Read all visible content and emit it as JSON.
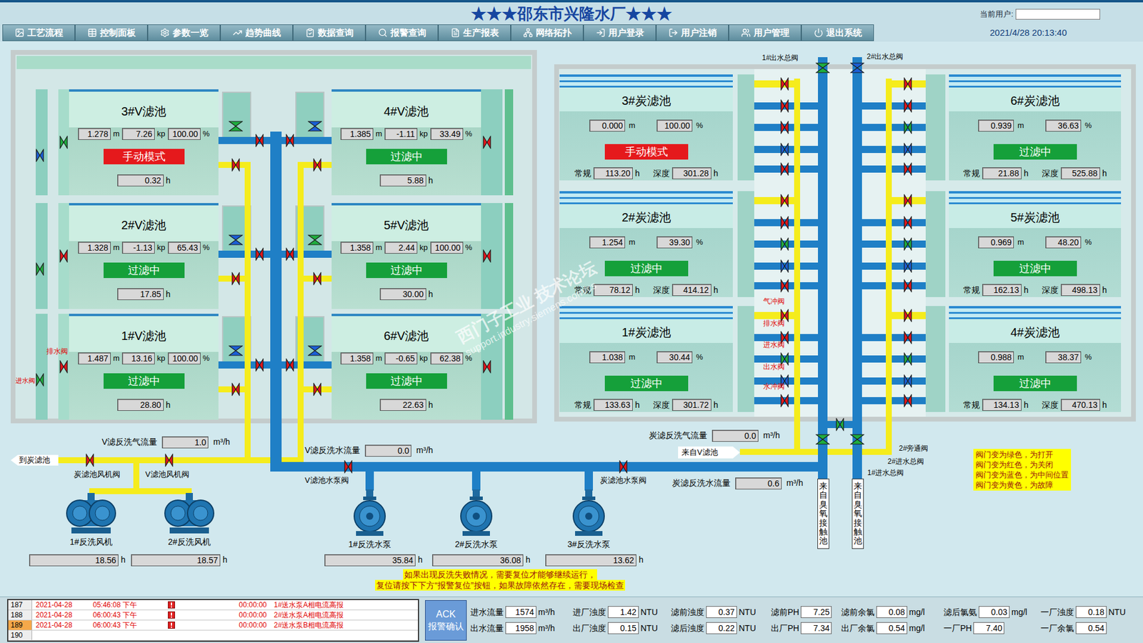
{
  "header": {
    "title": "★★★邵东市兴隆水厂★★★",
    "user_label": "当前用户:",
    "user_value": ""
  },
  "menu": [
    "工艺流程",
    "控制面板",
    "参数一览",
    "趋势曲线",
    "数据查询",
    "报警查询",
    "生产报表",
    "网络拓扑",
    "用户登录",
    "用户注销",
    "用户管理",
    "退出系统"
  ],
  "datetime": "2021/4/28 20:13:40",
  "v_units": {
    "level": "m",
    "pressure": "kp",
    "opening": "%",
    "hours": "h"
  },
  "v_filters": [
    {
      "name": "3#V滤池",
      "level": "1.278",
      "pressure": "7.26",
      "opening": "100.00",
      "status": "手动模式",
      "status_kind": "manual",
      "hours": "0.32",
      "valves": {
        "inlet": "middle",
        "drain": "open",
        "outlet": "open",
        "water": "closed",
        "air": "closed"
      }
    },
    {
      "name": "4#V滤池",
      "level": "1.385",
      "pressure": "-1.11",
      "opening": "33.49",
      "status": "过滤中",
      "status_kind": "filtering",
      "hours": "5.88",
      "valves": {
        "drain": "closed",
        "outlet": "middle",
        "water": "closed",
        "air": "closed"
      }
    },
    {
      "name": "2#V滤池",
      "level": "1.328",
      "pressure": "-1.13",
      "opening": "65.43",
      "status": "过滤中",
      "status_kind": "filtering",
      "hours": "17.85",
      "valves": {
        "inlet": "open",
        "drain": "closed",
        "outlet": "middle",
        "water": "closed",
        "air": "closed"
      }
    },
    {
      "name": "5#V滤池",
      "level": "1.358",
      "pressure": "2.44",
      "opening": "100.00",
      "status": "过滤中",
      "status_kind": "filtering",
      "hours": "30.00",
      "valves": {
        "drain": "closed",
        "outlet": "open",
        "water": "closed",
        "air": "closed"
      }
    },
    {
      "name": "1#V滤池",
      "level": "1.487",
      "pressure": "13.16",
      "opening": "100.00",
      "status": "过滤中",
      "status_kind": "filtering",
      "hours": "28.80",
      "valves": {
        "inlet": "open",
        "drain": "closed",
        "outlet": "middle",
        "water": "closed",
        "air": "closed"
      }
    },
    {
      "name": "6#V滤池",
      "level": "1.358",
      "pressure": "-0.65",
      "opening": "62.38",
      "status": "过滤中",
      "status_kind": "filtering",
      "hours": "22.63",
      "valves": {
        "drain": "closed",
        "outlet": "middle",
        "water": "closed",
        "air": "closed"
      }
    }
  ],
  "v_valve_labels": {
    "drain": "排水阀",
    "inlet": "进水阀"
  },
  "c_units": {
    "level": "m",
    "opening": "%",
    "normal": "常规",
    "deep": "深度",
    "hours": "h"
  },
  "carbon_filters": [
    {
      "name": "3#炭滤池",
      "level": "0.000",
      "opening": "100.00",
      "status": "手动模式",
      "status_kind": "manual",
      "normal_hours": "113.20",
      "deep_hours": "301.28",
      "valves": [
        "closed",
        "closed",
        "closed",
        "middle",
        "closed"
      ]
    },
    {
      "name": "6#炭滤池",
      "level": "0.939",
      "opening": "36.63",
      "status": "过滤中",
      "status_kind": "filtering",
      "normal_hours": "21.88",
      "deep_hours": "525.88",
      "valves": [
        "closed",
        "closed",
        "open",
        "middle",
        "closed"
      ]
    },
    {
      "name": "2#炭滤池",
      "level": "1.254",
      "opening": "39.30",
      "status": "过滤中",
      "status_kind": "filtering",
      "normal_hours": "78.12",
      "deep_hours": "414.12",
      "valves": [
        "closed",
        "closed",
        "open",
        "middle",
        "closed"
      ]
    },
    {
      "name": "5#炭滤池",
      "level": "0.969",
      "opening": "48.20",
      "status": "过滤中",
      "status_kind": "filtering",
      "normal_hours": "162.13",
      "deep_hours": "498.13",
      "valves": [
        "closed",
        "closed",
        "open",
        "middle",
        "closed"
      ]
    },
    {
      "name": "1#炭滤池",
      "level": "1.038",
      "opening": "30.44",
      "status": "过滤中",
      "status_kind": "filtering",
      "normal_hours": "133.63",
      "deep_hours": "301.72",
      "valves": [
        "closed",
        "closed",
        "open",
        "middle",
        "closed"
      ]
    },
    {
      "name": "4#炭滤池",
      "level": "0.988",
      "opening": "38.37",
      "status": "过滤中",
      "status_kind": "filtering",
      "normal_hours": "134.13",
      "deep_hours": "470.13",
      "valves": [
        "closed",
        "closed",
        "open",
        "middle",
        "closed"
      ]
    }
  ],
  "carbon_valve_labels": [
    "气冲阀",
    "排水阀",
    "进水阀",
    "出水阀",
    "水冲阀"
  ],
  "main_valves": [
    {
      "label": "1#出水总阀",
      "state": "open"
    },
    {
      "label": "2#出水总阀",
      "state": "middle"
    },
    {
      "label": "1#进水总阀",
      "state": "open"
    },
    {
      "label": "2#进水总阀",
      "state": "open"
    },
    {
      "label": "2#旁通阀",
      "state": "open"
    }
  ],
  "line_valves": [
    {
      "label": "炭滤池风机阀",
      "state": "closed"
    },
    {
      "label": "V滤池风机阀",
      "state": "closed"
    },
    {
      "label": "V滤池水泵阀",
      "state": "closed"
    },
    {
      "label": "炭滤池水泵阀",
      "state": "closed"
    }
  ],
  "flows": [
    {
      "label": "V滤反洗气流量",
      "value": "1.0",
      "unit": "m³/h"
    },
    {
      "label": "V滤反洗水流量",
      "value": "0.0",
      "unit": "m³/h"
    },
    {
      "label": "炭滤反洗气流量",
      "value": "0.0",
      "unit": "m³/h"
    },
    {
      "label": "炭滤反洗水流量",
      "value": "0.6",
      "unit": "m³/h"
    }
  ],
  "equipment_hours_unit": "h",
  "fans": [
    {
      "name": "1#反洗风机",
      "hours": "18.56"
    },
    {
      "name": "2#反洗风机",
      "hours": "18.57"
    }
  ],
  "pumps": [
    {
      "name": "1#反洗水泵",
      "hours": "35.84"
    },
    {
      "name": "2#反洗水泵",
      "hours": "36.08"
    },
    {
      "name": "3#反洗水泵",
      "hours": "13.62"
    }
  ],
  "arrows": {
    "to_carbon": "到炭滤池",
    "from_v": "来自V滤池",
    "from_ozone": [
      "来自臭氧接触池",
      "来自臭氧接触池"
    ]
  },
  "legend": [
    "阀门变为绿色，为打开",
    "阀门变为红色，为关闭",
    "阀门变为蓝色，为中间位置",
    "阀门变为黄色，为故障"
  ],
  "notice": [
    "如果出现反洗失败情况，需要复位才能够继续运行，",
    "复位请按下下方“报警复位”按钮，如果故障依然存在，需要现场检查"
  ],
  "watermark": [
    "西门子工业 技术论坛",
    "support.industry.siemens.com/cs"
  ],
  "alarms": [
    {
      "id": "187",
      "date": "2021-04-28",
      "time": "05:46:08 下午",
      "flag": true,
      "duration": "00:00:00",
      "message": "1#送水泵A相电流高报",
      "selected": false
    },
    {
      "id": "188",
      "date": "2021-04-28",
      "time": "06:00:43 下午",
      "flag": true,
      "duration": "00:00:00",
      "message": "2#送水泵A相电流高报",
      "selected": false
    },
    {
      "id": "189",
      "date": "2021-04-28",
      "time": "06:00:43 下午",
      "flag": true,
      "duration": "00:00:00",
      "message": "2#送水泵B相电流高报",
      "selected": true
    },
    {
      "id": "190",
      "date": "",
      "time": "",
      "flag": false,
      "duration": "",
      "message": "",
      "selected": false
    }
  ],
  "ack": {
    "line1": "ACK",
    "line2": "报警确认"
  },
  "metrics": [
    [
      {
        "label": "进水流量",
        "value": "1574",
        "unit": "m³/h"
      },
      {
        "label": "进厂浊度",
        "value": "1.42",
        "unit": "NTU"
      },
      {
        "label": "滤前浊度",
        "value": "0.37",
        "unit": "NTU"
      },
      {
        "label": "滤前PH",
        "value": "7.25",
        "unit": ""
      },
      {
        "label": "滤前余氯",
        "value": "0.08",
        "unit": "mg/l"
      },
      {
        "label": "滤后氯氨",
        "value": "0.03",
        "unit": "mg/l"
      },
      {
        "label": "一厂浊度",
        "value": "0.18",
        "unit": "NTU"
      }
    ],
    [
      {
        "label": "出水流量",
        "value": "1958",
        "unit": "m³/h"
      },
      {
        "label": "出厂浊度",
        "value": "0.15",
        "unit": "NTU"
      },
      {
        "label": "滤后浊度",
        "value": "0.22",
        "unit": "NTU"
      },
      {
        "label": "出厂PH",
        "value": "7.34",
        "unit": ""
      },
      {
        "label": "出厂余氯",
        "value": "0.54",
        "unit": "mg/l"
      },
      {
        "label": "一厂PH",
        "value": "7.40",
        "unit": ""
      },
      {
        "label": "一厂余氯",
        "value": "0.54",
        "unit": ""
      }
    ]
  ]
}
